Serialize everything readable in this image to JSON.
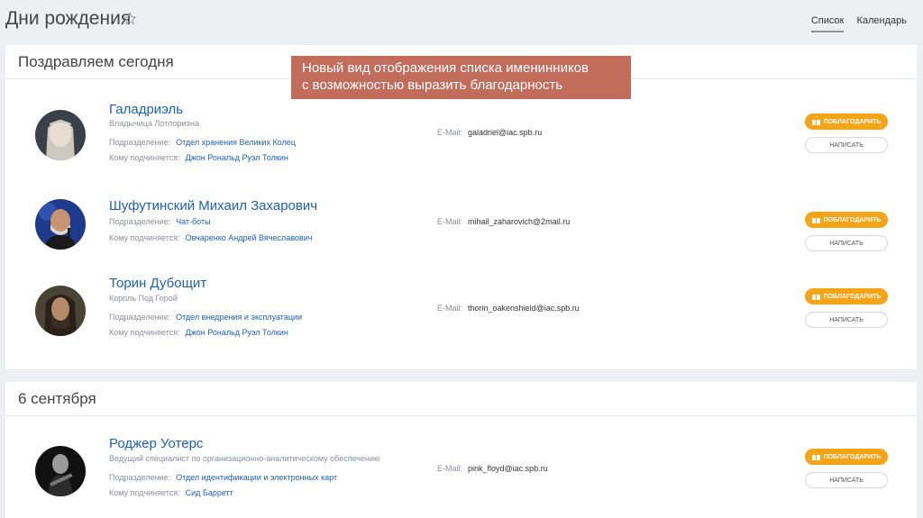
{
  "header": {
    "title": "Дни рождения",
    "tabs": [
      {
        "label": "Список",
        "active": true
      },
      {
        "label": "Календарь",
        "active": false
      }
    ]
  },
  "callout": {
    "line1": "Новый вид отображения списка именинников",
    "line2": "с возможностью выразить благодарность"
  },
  "labels": {
    "department": "Подразделение:",
    "manager": "Кому подчиняется:",
    "email": "E-Mail:",
    "thank": "ПОБЛАГОДАРИТЬ",
    "write": "НАПИСАТЬ"
  },
  "sections": [
    {
      "title": "Поздравляем сегодня",
      "people": [
        {
          "name": "Галадриэль",
          "position": "Владычица Лотлориэна",
          "department": "Отдел хранения Великих Колец",
          "manager": "Джон Рональд Руэл Толкин",
          "email": "galadriel@iac.spb.ru"
        },
        {
          "name": "Шуфутинский Михаил Захарович",
          "position": "",
          "department": "Чат-боты",
          "manager": "Овчаренко Андрей Вячеславович",
          "email": "mihail_zaharovich@2mail.ru"
        },
        {
          "name": "Торин Дубощит",
          "position": "Король Под Горой",
          "department": "Отдел внедрения и эксплуатации",
          "manager": "Джон Рональд Руэл Толкин",
          "email": "thorin_oakenshield@iac.spb.ru"
        }
      ]
    },
    {
      "title": "6 сентября",
      "people": [
        {
          "name": "Роджер Уотерс",
          "position": "Ведущий специалист по организационно-аналитическому обеспечению",
          "department": "Отдел идентификации и электронных карт",
          "manager": "Сид Барретт",
          "email": "pink_floyd@iac.spb.ru"
        }
      ]
    }
  ],
  "colors": {
    "accent_link": "#1d5fb7",
    "thank_button": "#f3a417",
    "callout": "#c26d5c"
  }
}
